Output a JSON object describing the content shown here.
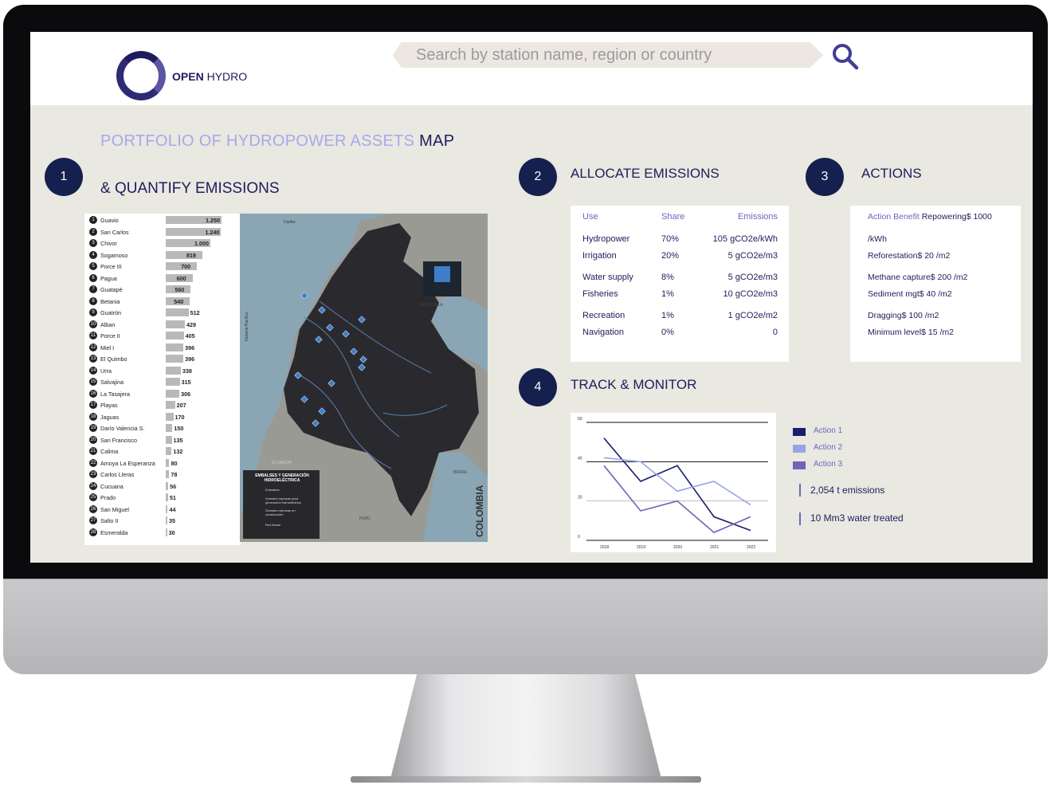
{
  "app": {
    "logo_bold": "OPEN",
    "logo_rest": " HYDRO"
  },
  "search": {
    "placeholder": "Search by station name, region or country"
  },
  "page": {
    "title_prefix": "PORTFOLIO  OF  HYDROPOWER  ASSETS ",
    "title_suffix": "MAP"
  },
  "sections": {
    "one": {
      "num": "1",
      "title": "& QUANTIFY EMISSIONS"
    },
    "two": {
      "num": "2",
      "title": "ALLOCATE EMISSIONS"
    },
    "three": {
      "num": "3",
      "title": "ACTIONS"
    },
    "four": {
      "num": "4",
      "title": "TRACK & MONITOR"
    }
  },
  "ranking": [
    {
      "num": "1",
      "name": "Guavio",
      "value": "1.250",
      "v": 1250
    },
    {
      "num": "2",
      "name": "San Carlos",
      "value": "1.240",
      "v": 1240
    },
    {
      "num": "3",
      "name": "Chivor",
      "value": "1.000",
      "v": 1000
    },
    {
      "num": "4",
      "name": "Sogamoso",
      "value": "819",
      "v": 819
    },
    {
      "num": "5",
      "name": "Porce III",
      "value": "700",
      "v": 700
    },
    {
      "num": "6",
      "name": "Pagua",
      "value": "600",
      "v": 600
    },
    {
      "num": "7",
      "name": "Guatapé",
      "value": "560",
      "v": 560
    },
    {
      "num": "8",
      "name": "Betania",
      "value": "540",
      "v": 540
    },
    {
      "num": "9",
      "name": "Guatrón",
      "value": "512",
      "v": 512
    },
    {
      "num": "10",
      "name": "Alban",
      "value": "429",
      "v": 429
    },
    {
      "num": "11",
      "name": "Porce II",
      "value": "405",
      "v": 405
    },
    {
      "num": "12",
      "name": "Miel I",
      "value": "396",
      "v": 396
    },
    {
      "num": "13",
      "name": "El Quimbo",
      "value": "396",
      "v": 396
    },
    {
      "num": "14",
      "name": "Urra",
      "value": "338",
      "v": 338
    },
    {
      "num": "15",
      "name": "Salvajina",
      "value": "315",
      "v": 315
    },
    {
      "num": "16",
      "name": "La Tasajera",
      "value": "306",
      "v": 306
    },
    {
      "num": "17",
      "name": "Playas",
      "value": "207",
      "v": 207
    },
    {
      "num": "18",
      "name": "Jaguas",
      "value": "170",
      "v": 170
    },
    {
      "num": "19",
      "name": "Darío Valencia S.",
      "value": "150",
      "v": 150
    },
    {
      "num": "20",
      "name": "San Francisco",
      "value": "135",
      "v": 135
    },
    {
      "num": "21",
      "name": "Calima",
      "value": "132",
      "v": 132
    },
    {
      "num": "22",
      "name": "Amoya La Esperanza",
      "value": "80",
      "v": 80
    },
    {
      "num": "23",
      "name": "Carlos Lleras",
      "value": "78",
      "v": 78
    },
    {
      "num": "24",
      "name": "Cucuana",
      "value": "56",
      "v": 56
    },
    {
      "num": "25",
      "name": "Prado",
      "value": "51",
      "v": 51
    },
    {
      "num": "26",
      "name": "San Miguel",
      "value": "44",
      "v": 44
    },
    {
      "num": "27",
      "name": "Salto II",
      "value": "35",
      "v": 35
    },
    {
      "num": "28",
      "name": "Esmeralda",
      "value": "30",
      "v": 30
    }
  ],
  "map": {
    "country": "COLOMBIA",
    "neighbor_east": "VENEZUELA",
    "neighbor_se": "BRASIL",
    "neighbor_s": "PERÚ",
    "neighbor_sw": "ECUADOR",
    "sea_north": "Caribe",
    "sea_west": "Océano Pacífico",
    "legend_title": "EMBALSES Y GENERACIÓN HIDROELÉCTRICA",
    "legend_items": [
      "Embalses",
      "Grandes represas para generación hidroeléctrica",
      "Grandes represas en construcción",
      "Red fluvial"
    ]
  },
  "allocation": {
    "headers": {
      "use": "Use",
      "share": "Share",
      "emissions": "Emissions"
    },
    "rows": [
      {
        "use": "Hydropower",
        "share": "70%",
        "emissions": "105 gCO2e/kWh"
      },
      {
        "use": "Irrigation",
        "share": "20%",
        "emissions": "5 gCO2e/m3"
      },
      {
        "use": "Water supply",
        "share": "8%",
        "emissions": "5 gCO2e/m3"
      },
      {
        "use": "Fisheries",
        "share": "1%",
        "emissions": "10 gCO2e/m3"
      },
      {
        "use": "Recreation",
        "share": "1%",
        "emissions": "1 gCO2e/m2"
      },
      {
        "use": "Navigation",
        "share": "0%",
        "emissions": "0"
      }
    ]
  },
  "actions": {
    "head_light": "Action Benefit",
    "head_dark": " Repowering$ 1000",
    "lines": [
      "/kWh",
      "Reforestation$ 20 /m2",
      "Methane capture$ 200 /m2",
      "Sediment mgt$ 40 /m2",
      "Dragging$ 100 /m2",
      "Minimum level$ 15 /m2"
    ]
  },
  "chart_data": {
    "type": "line",
    "x": [
      "2018",
      "2019",
      "2020",
      "2021",
      "2022"
    ],
    "ylim": [
      0,
      60
    ],
    "yticks": [
      "0",
      "20",
      "40",
      "60"
    ],
    "series": [
      {
        "name": "Action  1",
        "color": "#1b1d6b",
        "values": [
          52,
          30,
          38,
          12,
          5
        ]
      },
      {
        "name": "Action  2",
        "color": "#9aa2e6",
        "values": [
          42,
          40,
          25,
          30,
          18
        ]
      },
      {
        "name": "Action 3",
        "color": "#6c65b8",
        "values": [
          38,
          15,
          20,
          4,
          12
        ]
      }
    ]
  },
  "kpis": [
    "2,054 t emissions",
    "10 Mm3 water treated"
  ]
}
